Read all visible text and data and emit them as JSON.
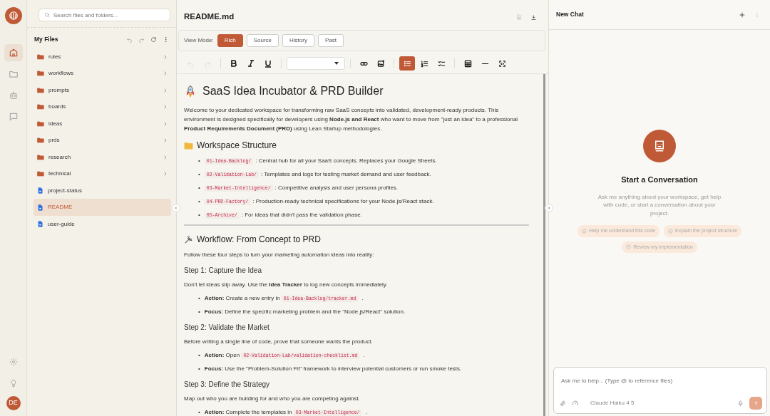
{
  "rail": {
    "items": [
      {
        "kind": "home",
        "selected": true
      },
      {
        "kind": "folder",
        "selected": false
      },
      {
        "kind": "bot",
        "selected": false
      },
      {
        "kind": "chat",
        "selected": false
      }
    ],
    "avatar": "DE"
  },
  "files": {
    "search": {
      "placeholder": "Search files and folders..."
    },
    "title": "My Files",
    "items": [
      {
        "name": "rules",
        "kind": "folder",
        "selected": false
      },
      {
        "name": "workflows",
        "kind": "folder",
        "selected": false
      },
      {
        "name": "prompts",
        "kind": "folder",
        "selected": false
      },
      {
        "name": "boards",
        "kind": "folder",
        "selected": false
      },
      {
        "name": "ideas",
        "kind": "folder",
        "selected": false
      },
      {
        "name": "prds",
        "kind": "folder",
        "selected": false
      },
      {
        "name": "research",
        "kind": "folder",
        "selected": false
      },
      {
        "name": "technical",
        "kind": "folder",
        "selected": false
      },
      {
        "name": "project-status",
        "kind": "file",
        "selected": false
      },
      {
        "name": "README",
        "kind": "file",
        "selected": true
      },
      {
        "name": "user-guide",
        "kind": "file",
        "selected": false
      }
    ]
  },
  "editor": {
    "title": "README.md",
    "view_mode_label": "View Mode:",
    "modes": [
      {
        "label": "Rich",
        "selected": true
      },
      {
        "label": "Source",
        "selected": false
      },
      {
        "label": "History",
        "selected": false
      },
      {
        "label": "Past",
        "selected": false
      }
    ],
    "toolbar": [
      {
        "kind": "undo",
        "disabled": true,
        "selected": false
      },
      {
        "kind": "redo",
        "disabled": true,
        "selected": false
      },
      {
        "kind": "sep"
      },
      {
        "kind": "bold",
        "disabled": false,
        "selected": false
      },
      {
        "kind": "italic",
        "disabled": false,
        "selected": false
      },
      {
        "kind": "underline",
        "disabled": false,
        "selected": false
      },
      {
        "kind": "sep"
      },
      {
        "kind": "select"
      },
      {
        "kind": "sep"
      },
      {
        "kind": "link",
        "disabled": false,
        "selected": false
      },
      {
        "kind": "image",
        "disabled": false,
        "selected": false
      },
      {
        "kind": "sep"
      },
      {
        "kind": "bullets",
        "disabled": false,
        "selected": true
      },
      {
        "kind": "numbers",
        "disabled": false,
        "selected": false
      },
      {
        "kind": "tasks",
        "disabled": false,
        "selected": false
      },
      {
        "kind": "sep"
      },
      {
        "kind": "table",
        "disabled": false,
        "selected": false
      },
      {
        "kind": "rule",
        "disabled": false,
        "selected": false
      },
      {
        "kind": "code",
        "disabled": false,
        "selected": false
      }
    ],
    "document": [
      {
        "kind": "h1",
        "text": "SaaS Idea Incubator & PRD Builder"
      },
      {
        "kind": "p",
        "text": "Welcome to your dedicated workspace for transforming raw SaaS concepts into validated, development-ready products. This environment is designed specifically for developers using **Node.js and React** who want to move from \"just an idea\" to a professional **Product Requirements Document (PRD)** using Lean Startup methodologies."
      },
      {
        "kind": "h2",
        "text": "Workspace Structure"
      },
      {
        "kind": "ul",
        "marker": "•",
        "items": [
          {
            "code": "01-Idea-Backlog/",
            "text": ": Central hub for all your SaaS concepts. Replaces your Google Sheets."
          },
          {
            "code": "02-Validation-Lab/",
            "text": ": Templates and logs for testing market demand and user feedback."
          },
          {
            "code": "03-Market-Intelligence/",
            "text": ": Competitive analysis and user persona profiles."
          },
          {
            "code": "04-PRD-Factory/",
            "text": ": Production-ready technical specifications for your Node.js/React stack."
          },
          {
            "code": "05-Archive/",
            "text": ": For ideas that didn't pass the validation phase."
          }
        ]
      },
      {
        "kind": "hr"
      },
      {
        "kind": "h2",
        "text": "Workflow: From Concept to PRD"
      },
      {
        "kind": "p",
        "text": "Follow these four steps to turn your marketing automation ideas into reality:"
      },
      {
        "kind": "h3",
        "text": "Step 1: Capture the Idea"
      },
      {
        "kind": "p",
        "text": "Don't let ideas slip away. Use the **Idea Tracker** to log new concepts immediately."
      },
      {
        "kind": "ul",
        "marker": "•",
        "items": [
          {
            "lead": "Action:",
            "text": "Create a new entry in",
            "code": "01-Idea-Backlog/tracker.md",
            "tail": "."
          },
          {
            "lead": "Focus:",
            "text": "Define the specific marketing problem and the \"Node.js/React\" solution."
          }
        ]
      },
      {
        "kind": "h3",
        "text": "Step 2: Validate the Market"
      },
      {
        "kind": "p",
        "text": "Before writing a single line of code, prove that someone wants the product."
      },
      {
        "kind": "ul",
        "marker": "•",
        "items": [
          {
            "lead": "Action:",
            "text": "Open",
            "code": "02-Validation-Lab/validation-checklist.md",
            "tail": "."
          },
          {
            "lead": "Focus:",
            "text": "Use the \"Problem-Solution Fit\" framework to interview potential customers or run smoke tests."
          }
        ]
      },
      {
        "kind": "h3",
        "text": "Step 3: Define the Strategy"
      },
      {
        "kind": "p",
        "text": "Map out who you are building for and who you are competing against."
      },
      {
        "kind": "ul",
        "marker": "•",
        "items": [
          {
            "lead": "Action:",
            "text": "Complete the templates in",
            "code": "03-Market-Intelligence/",
            "tail": "."
          }
        ]
      }
    ]
  },
  "chat": {
    "title": "New Chat",
    "heading": "Start a Conversation",
    "description": "Ask me anything about your workspace, get help with code, or start a conversation about your project.",
    "suggestions": [
      "Help me understand this code",
      "Explain the project structure",
      "Review my implementation"
    ],
    "input": {
      "placeholder": "Ask me to help... (Type @ to reference files)"
    },
    "model": "Claude Haiku 4 5"
  }
}
